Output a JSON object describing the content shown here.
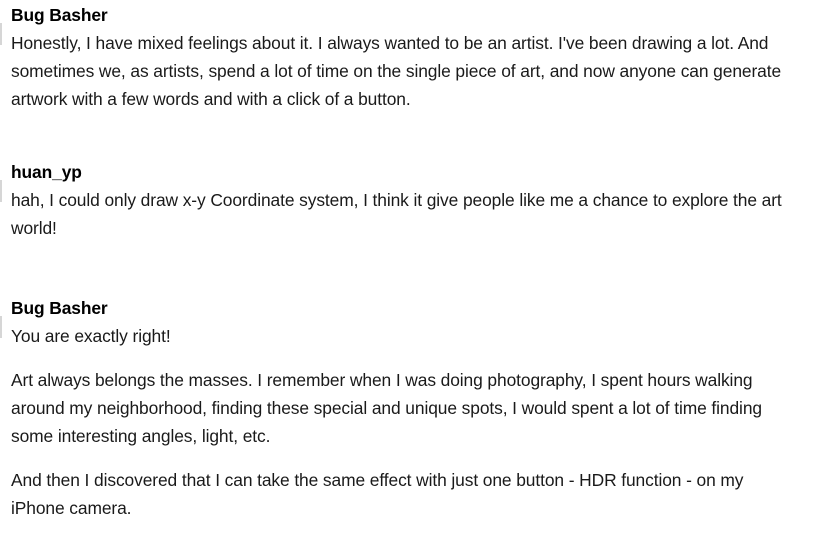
{
  "comments": [
    {
      "author": "Bug Basher",
      "paragraphs": [
        "Honestly, I have mixed feelings about it. I always wanted to be an artist. I've been drawing a lot. And sometimes we, as artists, spend a lot of time on the single piece of art, and now anyone can generate artwork with a few words and with a click of a button."
      ]
    },
    {
      "author": "huan_yp",
      "paragraphs": [
        "hah, I could only draw x-y Coordinate system, I think it give people like me a chance to explore the art world!"
      ]
    },
    {
      "author": "Bug Basher",
      "paragraphs": [
        "You are exactly right!",
        "Art always belongs the masses. I remember when I was doing photography, I spent hours walking around my neighborhood, finding these special and unique spots, I would spent a lot of time finding some interesting angles, light, etc.",
        "And then I discovered that I can take the same effect with just one button - HDR function - on my iPhone camera."
      ]
    }
  ]
}
